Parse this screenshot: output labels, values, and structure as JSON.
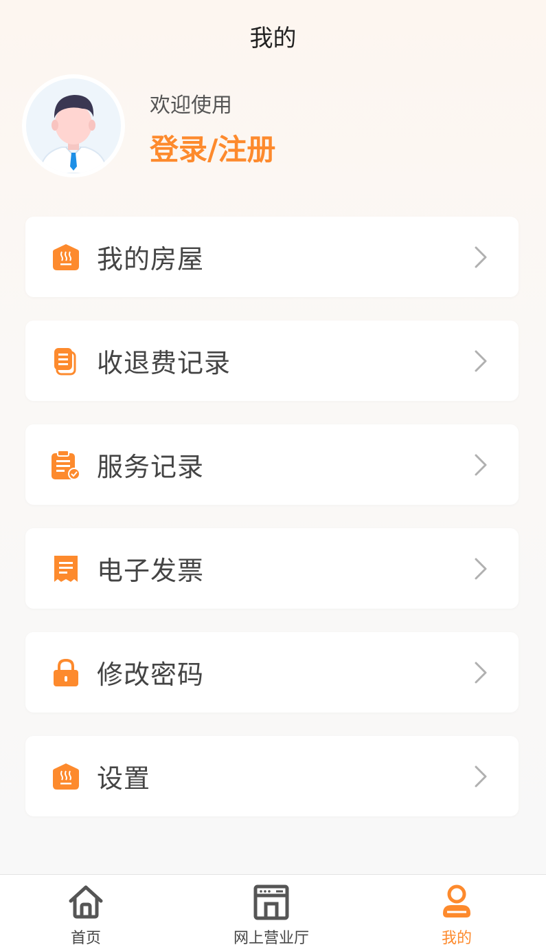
{
  "header": {
    "title": "我的"
  },
  "profile": {
    "welcome_text": "欢迎使用",
    "login_label": "登录/注册"
  },
  "menu": {
    "items": [
      {
        "label": "我的房屋",
        "icon": "house-icon"
      },
      {
        "label": "收退费记录",
        "icon": "receipt-list-icon"
      },
      {
        "label": "服务记录",
        "icon": "clipboard-check-icon"
      },
      {
        "label": "电子发票",
        "icon": "invoice-icon"
      },
      {
        "label": "修改密码",
        "icon": "lock-icon"
      },
      {
        "label": "设置",
        "icon": "house-icon"
      }
    ]
  },
  "tabbar": {
    "tabs": [
      {
        "label": "首页",
        "icon": "home-icon",
        "active": false
      },
      {
        "label": "网上营业厅",
        "icon": "store-icon",
        "active": false
      },
      {
        "label": "我的",
        "icon": "user-icon",
        "active": true
      }
    ]
  },
  "colors": {
    "accent": "#fd8a2d",
    "icon_gray": "#555555",
    "arrow": "#b0b0b0"
  }
}
